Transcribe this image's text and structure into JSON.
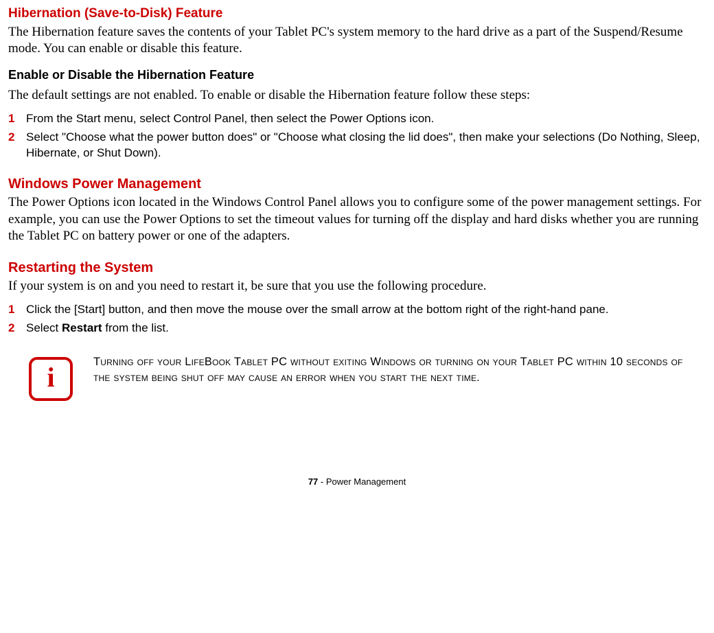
{
  "section1": {
    "heading": "Hibernation (Save-to-Disk) Feature",
    "body": "The Hibernation feature saves the contents of your Tablet PC's system memory to the hard drive as a part of the Suspend/Resume mode. You can enable or disable this feature.",
    "subheading": "Enable or Disable the Hibernation Feature",
    "subbody": "The default settings are not enabled. To enable or disable the Hibernation feature follow these steps:",
    "steps": [
      {
        "num": "1",
        "text": "From the Start menu, select Control Panel, then select the Power Options icon."
      },
      {
        "num": "2",
        "text": "Select \"Choose what the power button does\" or \"Choose what closing the lid does\", then make your selections (Do Nothing, Sleep, Hibernate, or Shut Down)."
      }
    ]
  },
  "section2": {
    "heading": "Windows Power Management",
    "body": "The Power Options icon located in the Windows Control Panel allows you to configure some of the power management settings. For example, you can use the Power Options to set the timeout values for turning off the display and hard disks whether you are running the Tablet PC on battery power or one of the adapters."
  },
  "section3": {
    "heading": "Restarting the System",
    "body": "If your system is on and you need to restart it, be sure that you use the following procedure.",
    "steps": [
      {
        "num": "1",
        "text": "Click the [Start] button, and then move the mouse over the small arrow at the bottom right of the right-hand pane."
      },
      {
        "num": "2",
        "prefix": "Select ",
        "bold": "Restart",
        "suffix": " from the list."
      }
    ]
  },
  "info": {
    "icon_letter": "i",
    "text": "Turning off your LifeBook Tablet PC without exiting Windows or turning on your Tablet PC within 10 seconds of the system being shut off may cause an error when you start the next time."
  },
  "footer": {
    "page": "77",
    "sep": " - ",
    "title": "Power Management"
  }
}
